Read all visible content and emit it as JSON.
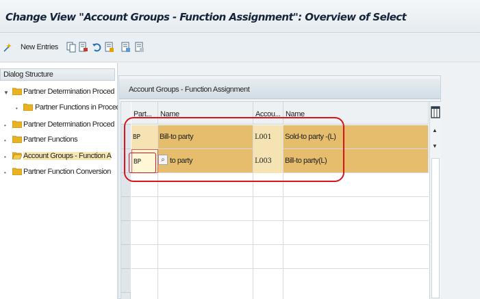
{
  "window": {
    "title": "Change View \"Account Groups - Function Assignment\": Overview of Select"
  },
  "toolbar": {
    "new_entries_label": "New Entries",
    "icons": [
      "new-entries-icon",
      "copy-icon",
      "delete-icon",
      "undo-icon",
      "select-all-icon",
      "select-block-icon",
      "deselect-all-icon"
    ]
  },
  "dialog_structure": {
    "header": "Dialog Structure",
    "items": [
      {
        "label": "Partner Determination Proced",
        "level": 0,
        "expanded": true,
        "selected": false
      },
      {
        "label": "Partner Functions in Proced",
        "level": 1,
        "expanded": false,
        "selected": false
      },
      {
        "label": "Partner Determination Proced",
        "level": 0,
        "expanded": false,
        "selected": false
      },
      {
        "label": "Partner Functions",
        "level": 0,
        "expanded": false,
        "selected": false
      },
      {
        "label": "Account Groups - Function A",
        "level": 0,
        "expanded": false,
        "selected": true
      },
      {
        "label": "Partner Function Conversion",
        "level": 0,
        "expanded": false,
        "selected": false
      }
    ]
  },
  "table": {
    "group_title": "Account Groups - Function Assignment",
    "columns": [
      "Part...",
      "Name",
      "Accou...",
      "Name"
    ],
    "rows": [
      {
        "partner_function": "BP",
        "name": "Bill-to party",
        "account_group": "L001",
        "account_group_name": "Sold-to party -(L)"
      },
      {
        "partner_function": "BP",
        "name": "to party",
        "account_group": "L003",
        "account_group_name": "Bill-to party(L)"
      }
    ],
    "empty_rows": 5,
    "f4_help_icon": "search-icon"
  },
  "colors": {
    "selected_row": "#e5bd6c",
    "highlight_ring": "#d8141a",
    "title_text": "#14243a"
  }
}
